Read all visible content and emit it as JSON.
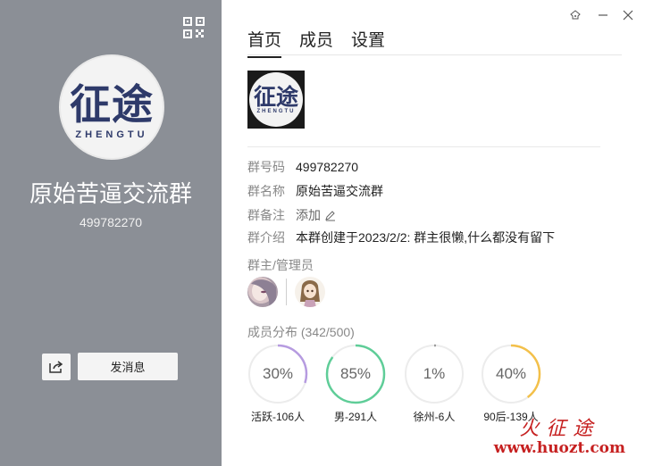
{
  "profile": {
    "logo_text": "征途",
    "logo_sub": "ZHENGTU",
    "name": "原始苦逼交流群",
    "id": "499782270",
    "send_message": "发消息"
  },
  "tabs": [
    {
      "label": "首页",
      "active": true
    },
    {
      "label": "成员",
      "active": false
    },
    {
      "label": "设置",
      "active": false
    }
  ],
  "info": {
    "number_label": "群号码",
    "number_value": "499782270",
    "name_label": "群名称",
    "name_value": "原始苦逼交流群",
    "remark_label": "群备注",
    "remark_action": "添加",
    "intro_label": "群介绍",
    "intro_value": "本群创建于2023/2/2:  群主很懒,什么都没有留下"
  },
  "admins_label": "群主/管理员",
  "distribution": {
    "title": "成员分布",
    "count": "(342/500)",
    "items": [
      {
        "percent_text": "30%",
        "fraction": 0.3,
        "caption": "活跃-106人",
        "color": "#b69be0"
      },
      {
        "percent_text": "85%",
        "fraction": 0.85,
        "caption": "男-291人",
        "color": "#5fcd98"
      },
      {
        "percent_text": "1%",
        "fraction": 0.01,
        "caption": "徐州-6人",
        "color": "#9a9a9a"
      },
      {
        "percent_text": "40%",
        "fraction": 0.4,
        "caption": "90后-139人",
        "color": "#f3c04a"
      }
    ]
  },
  "watermark": {
    "chinese": "火征途",
    "url": "www.huozt.com"
  },
  "colors": {
    "left_panel": "#8b8f96",
    "watermark": "#c62020"
  }
}
